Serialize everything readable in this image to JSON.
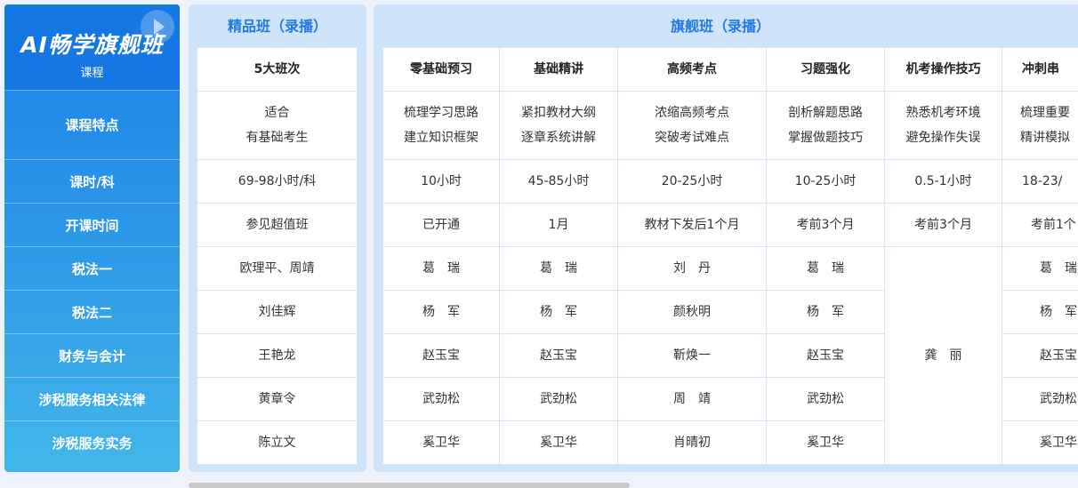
{
  "brand": {
    "title": "AI畅学旗舰班",
    "subtitle": "课程"
  },
  "row_headers": [
    "课程特点",
    "课时/科",
    "开课时间",
    "税法一",
    "税法二",
    "财务与会计",
    "涉税服务相关法律",
    "涉税服务实务"
  ],
  "panel_premium": {
    "title": "精品班（录播）",
    "header": "5大班次",
    "cells": [
      "适合\n有基础考生",
      "69-98小时/科",
      "参见超值班",
      "欧理平、周靖",
      "刘佳辉",
      "王艳龙",
      "黄章令",
      "陈立文"
    ]
  },
  "panel_flagship": {
    "title": "旗舰班（录播）",
    "columns": [
      {
        "header": "零基础预习",
        "feature": "梳理学习思路\n建立知识框架",
        "hours": "10小时",
        "start": "已开通",
        "teachers": [
          "葛　瑞",
          "杨　军",
          "赵玉宝",
          "武劲松",
          "奚卫华"
        ]
      },
      {
        "header": "基础精讲",
        "feature": "紧扣教材大纲\n逐章系统讲解",
        "hours": "45-85小时",
        "start": "1月",
        "teachers": [
          "葛　瑞",
          "杨　军",
          "赵玉宝",
          "武劲松",
          "奚卫华"
        ]
      },
      {
        "header": "高频考点",
        "feature": "浓缩高频考点\n突破考试难点",
        "hours": "20-25小时",
        "start": "教材下发后1个月",
        "teachers": [
          "刘　丹",
          "颜秋明",
          "靳焕一",
          "周　靖",
          "肖晴初"
        ]
      },
      {
        "header": "习题强化",
        "feature": "剖析解题思路\n掌握做题技巧",
        "hours": "10-25小时",
        "start": "考前3个月",
        "teachers": [
          "葛　瑞",
          "杨　军",
          "赵玉宝",
          "武劲松",
          "奚卫华"
        ]
      },
      {
        "header": "机考操作技巧",
        "feature": "熟悉机考环境\n避免操作失误",
        "hours": "0.5-1小时",
        "start": "考前3个月",
        "teachers_merged": "龚　丽"
      },
      {
        "header": "冲刺串",
        "feature": "梳理重要\n精讲模拟",
        "hours": "18-23/",
        "start": "考前1个",
        "teachers": [
          "葛　瑞",
          "杨　军",
          "赵玉宝",
          "武劲松",
          "奚卫华"
        ]
      }
    ]
  }
}
